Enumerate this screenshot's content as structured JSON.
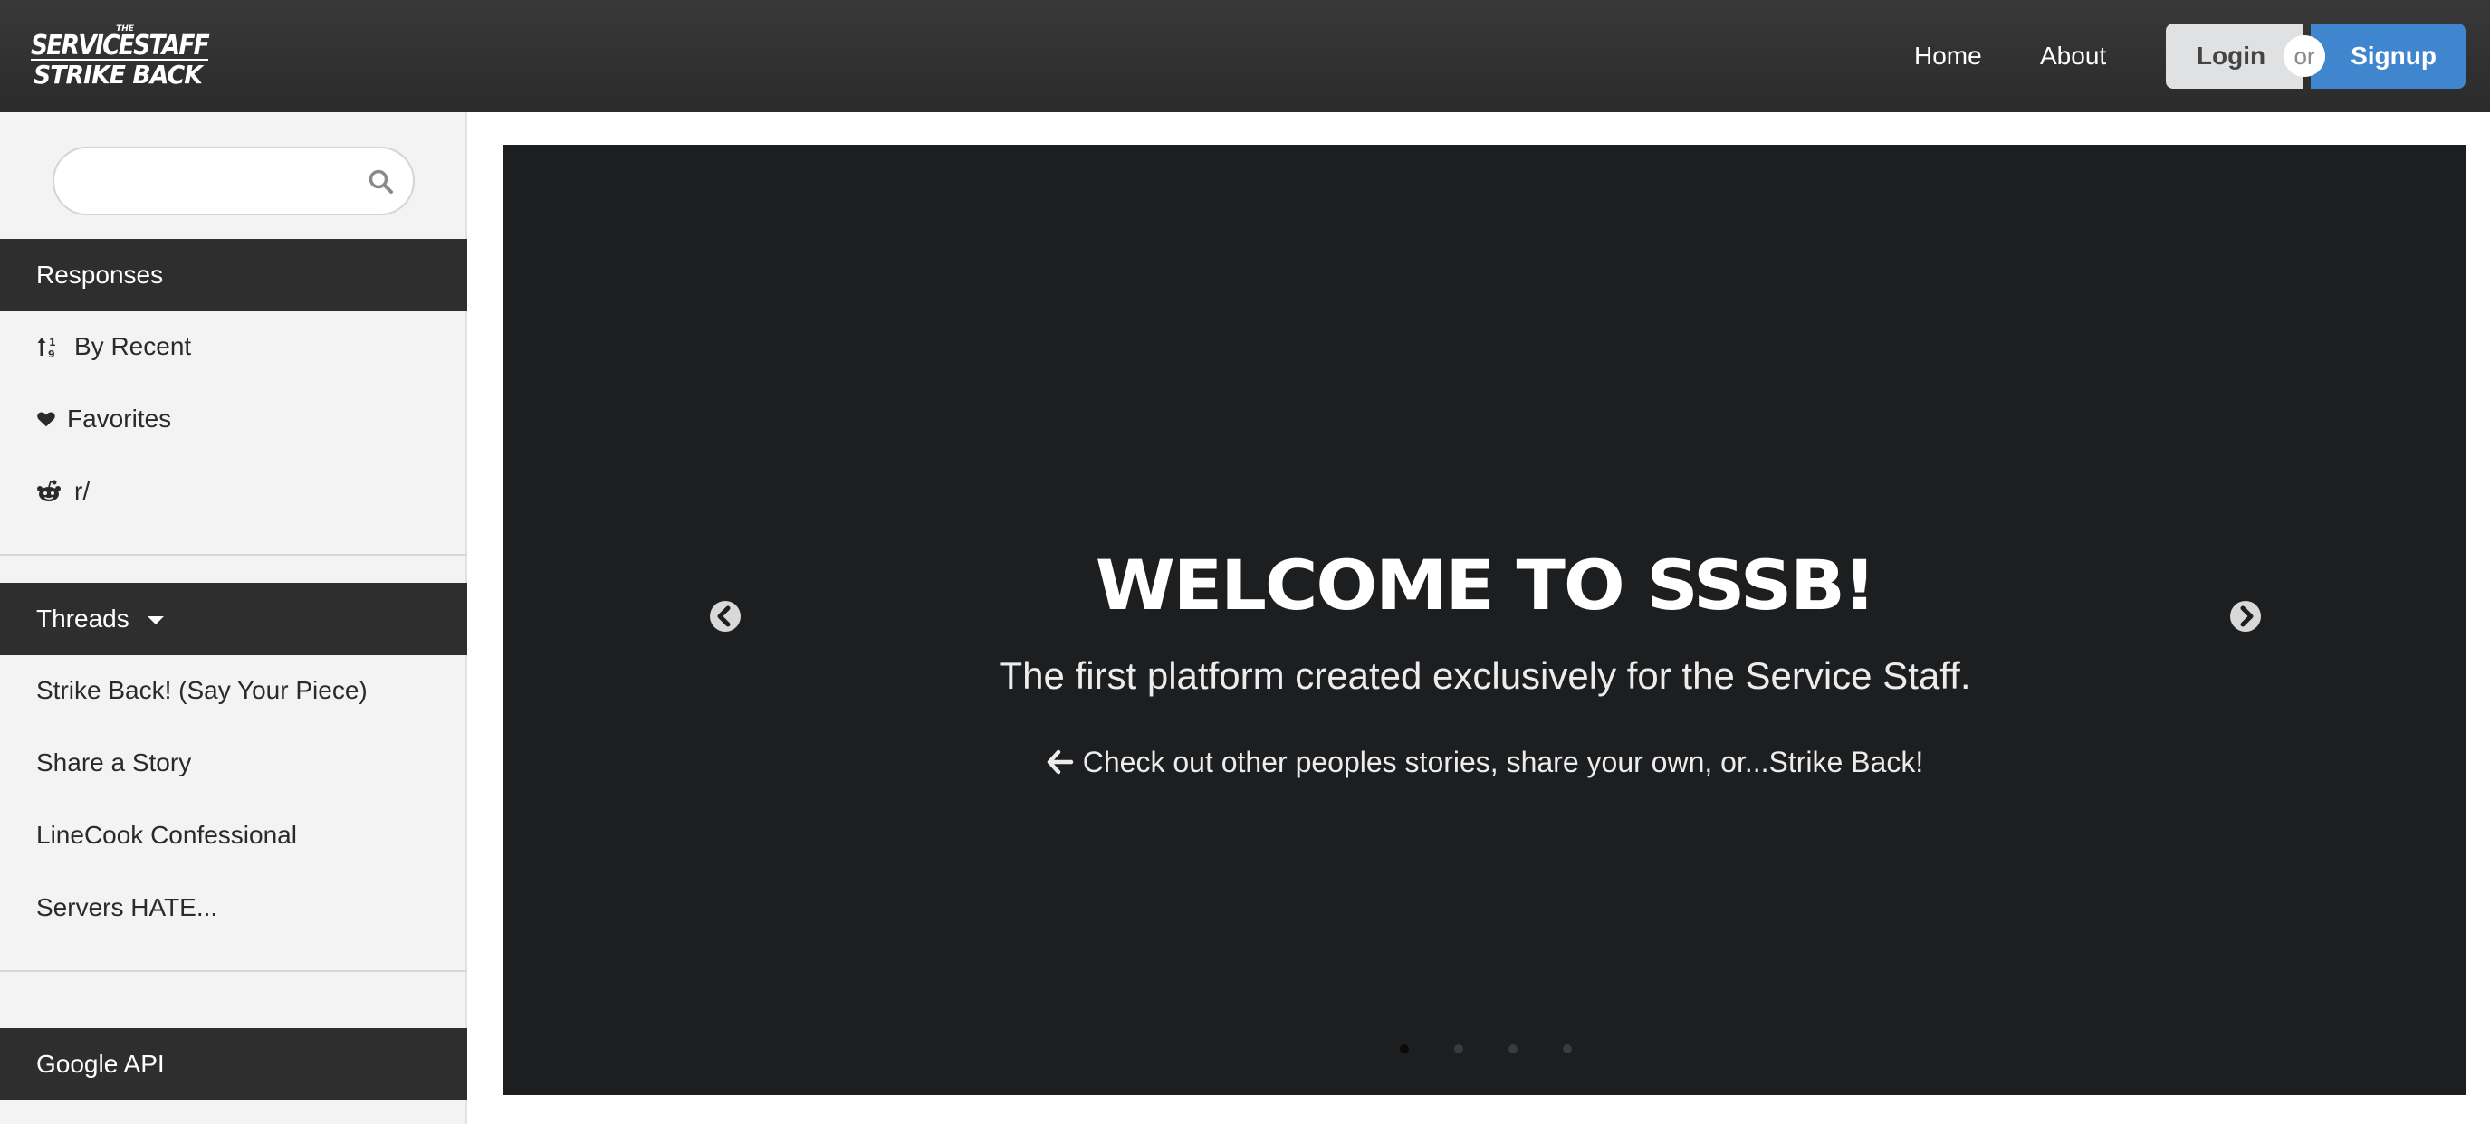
{
  "header": {
    "logo": {
      "text_top": "THE",
      "text_main": "SERVICESTAFF",
      "text_bottom": "STRIKE BACK"
    },
    "nav": {
      "home": "Home",
      "about": "About"
    },
    "auth": {
      "login": "Login",
      "or": "or",
      "signup": "Signup"
    },
    "colors": {
      "bar": "#2f2f2f",
      "signup": "#3f86cf",
      "login": "#e0e1e2"
    }
  },
  "sidebar": {
    "search": {
      "placeholder": "",
      "icon": "search-icon"
    },
    "responses": {
      "title": "Responses",
      "items": [
        {
          "label": "By Recent",
          "icon": "sort-numeric-icon"
        },
        {
          "label": "Favorites",
          "icon": "heart-icon"
        },
        {
          "label": "r/",
          "icon": "reddit-icon"
        }
      ]
    },
    "threads": {
      "title": "Threads",
      "items": [
        {
          "label": "Strike Back! (Say Your Piece)"
        },
        {
          "label": "Share a Story"
        },
        {
          "label": "LineCook Confessional"
        },
        {
          "label": "Servers HATE..."
        }
      ]
    },
    "google": {
      "title": "Google API"
    }
  },
  "carousel": {
    "title": "WELCOME TO SSSB!",
    "subtitle": "The first platform created exclusively for the Service Staff.",
    "cta": "Check out other peoples stories, share your own, or...Strike Back!",
    "slides_count": 4,
    "active_slide": 1,
    "background": "#1d1e20"
  }
}
